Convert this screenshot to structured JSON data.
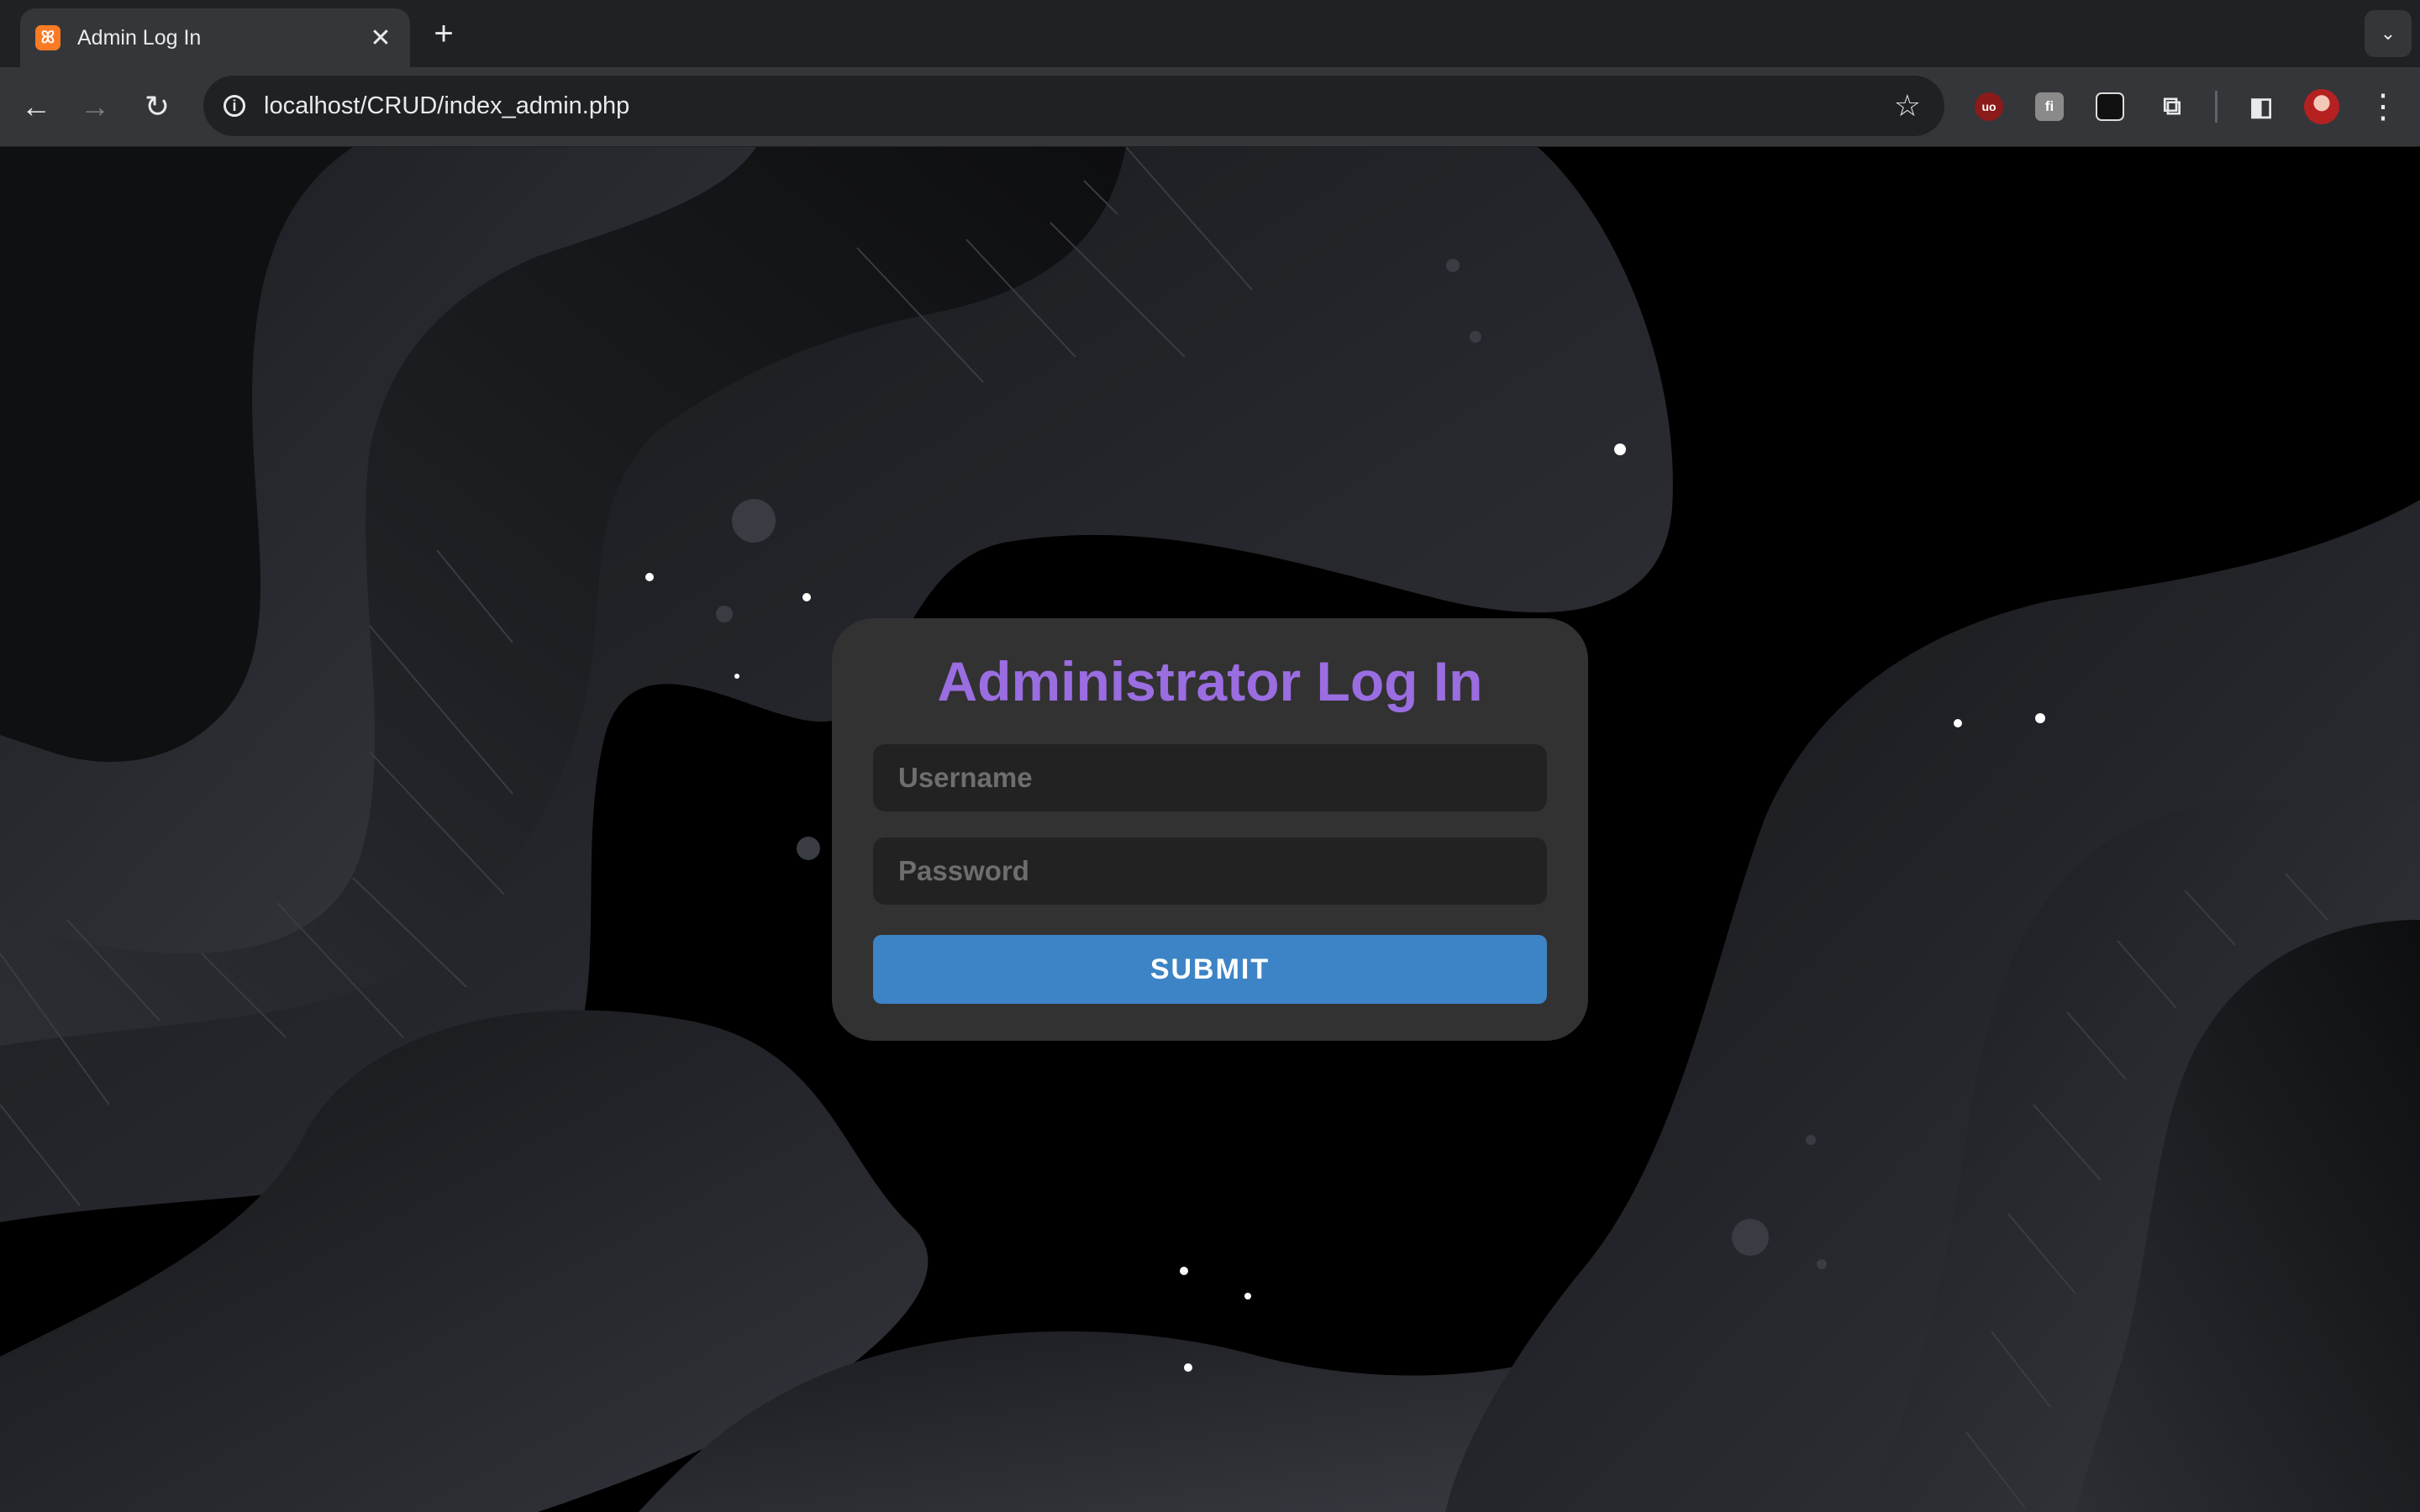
{
  "browser": {
    "tab_title": "Admin Log In",
    "tab_favicon": "xampp-icon",
    "url": "localhost/CRUD/index_admin.php",
    "new_tab_label": "+",
    "close_label": "✕"
  },
  "page": {
    "title": "Administrator Log In",
    "username_placeholder": "Username",
    "password_placeholder": "Password",
    "submit_label": "SUBMIT"
  },
  "colors": {
    "title": "#9a6de1",
    "submit": "#3d84c6",
    "card": "#323232",
    "field": "#222222"
  }
}
